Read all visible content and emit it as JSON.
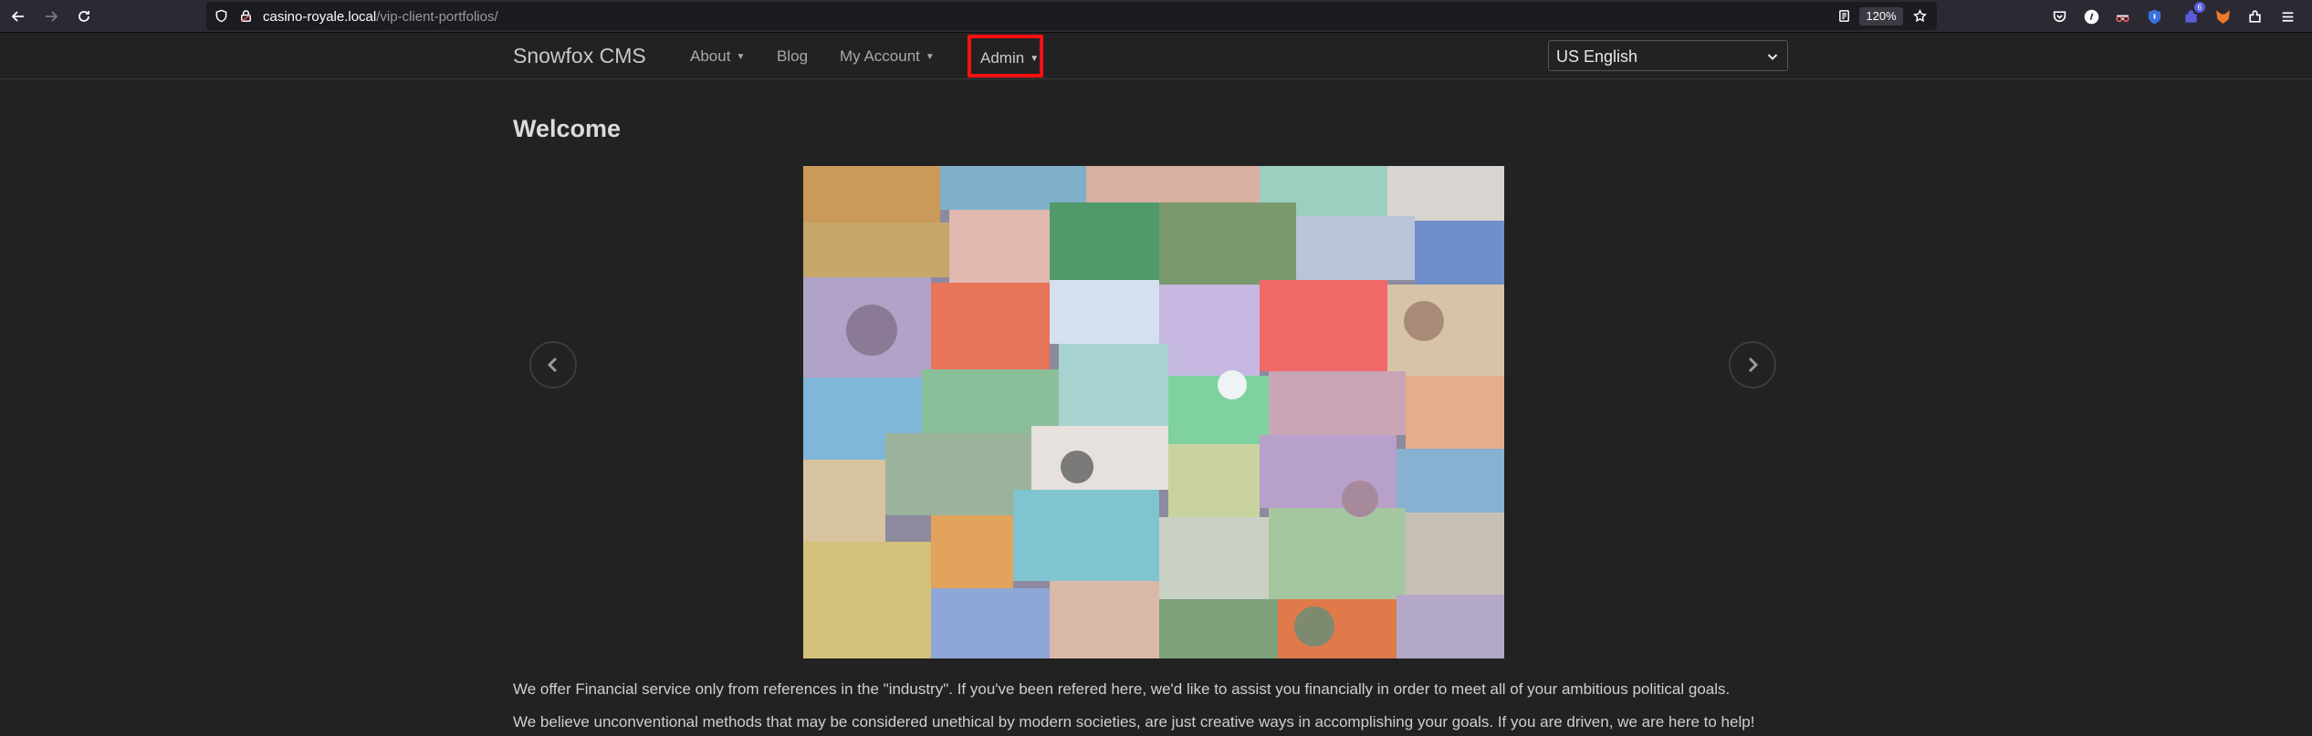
{
  "browser": {
    "url_host": "casino-royale.local",
    "url_path": "/vip-client-portfolios/",
    "zoom": "120%",
    "extension_badge": "6"
  },
  "nav": {
    "brand": "Snowfox CMS",
    "items": [
      {
        "label": "About",
        "dropdown": true
      },
      {
        "label": "Blog",
        "dropdown": false
      },
      {
        "label": "My Account",
        "dropdown": true
      },
      {
        "label": "Admin",
        "dropdown": true,
        "highlighted": true
      }
    ],
    "language": {
      "selected": "US English"
    }
  },
  "main": {
    "heading": "Welcome",
    "carousel": {
      "image_subject": "collage of world banknotes"
    },
    "paragraphs": [
      "We offer Financial service only from references in the \"industry\". If you've been refered here, we'd like to assist you financially in order to meet all of your ambitious political goals.",
      "We believe unconventional methods that may be considered unethical by modern societies, are just creative ways in accomplishing your goals. If you are driven, we are here to help!"
    ]
  },
  "colors": {
    "page_bg": "#222222",
    "highlight_border": "#ff1010",
    "chrome_bg": "#2b2a33"
  }
}
